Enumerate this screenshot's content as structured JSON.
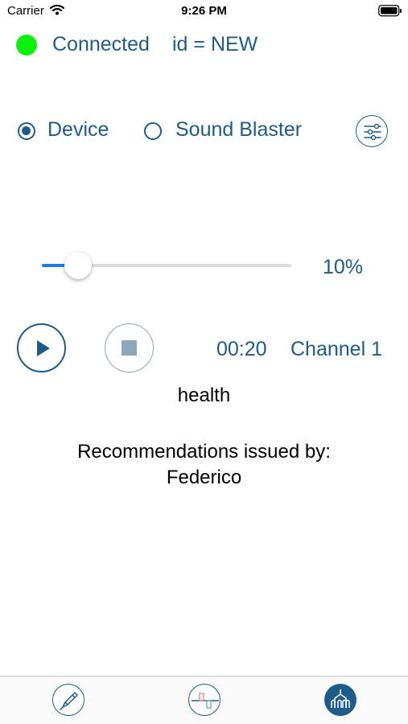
{
  "status_bar": {
    "carrier": "Carrier",
    "time": "9:26 PM"
  },
  "connection": {
    "status": "Connected",
    "id_text": "id = NEW",
    "indicator_color": "#0df20d"
  },
  "source": {
    "options": [
      "Device",
      "Sound Blaster"
    ],
    "selected": "Device"
  },
  "level": {
    "display": "10%",
    "fraction": 0.1
  },
  "player": {
    "elapsed": "00:20",
    "channel": "Channel 1"
  },
  "program_name": "health",
  "recommendation": {
    "line1": "Recommendations issued by:",
    "line2": "Federico"
  },
  "colors": {
    "accent": "#1e5b8a",
    "slider_fill": "#1a7cf0",
    "stop_disabled": "#8da6bd"
  },
  "tab_bar": {
    "tabs": [
      "pen-icon",
      "chart-icon",
      "network-icon"
    ],
    "active_index": 2
  }
}
